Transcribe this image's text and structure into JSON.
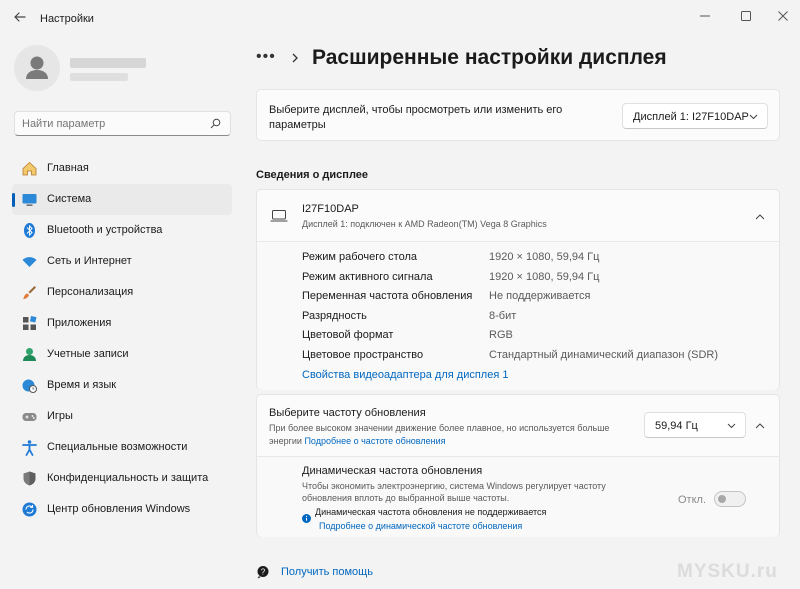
{
  "window": {
    "title": "Настройки"
  },
  "search": {
    "placeholder": "Найти параметр"
  },
  "sidebar": {
    "items": [
      {
        "label": "Главная",
        "icon": "home-icon"
      },
      {
        "label": "Система",
        "icon": "system-icon",
        "active": true
      },
      {
        "label": "Bluetooth и устройства",
        "icon": "bluetooth-icon"
      },
      {
        "label": "Сеть и Интернет",
        "icon": "wifi-icon"
      },
      {
        "label": "Персонализация",
        "icon": "brush-icon"
      },
      {
        "label": "Приложения",
        "icon": "apps-icon"
      },
      {
        "label": "Учетные записи",
        "icon": "account-icon"
      },
      {
        "label": "Время и язык",
        "icon": "globe-clock-icon"
      },
      {
        "label": "Игры",
        "icon": "gamepad-icon"
      },
      {
        "label": "Специальные возможности",
        "icon": "accessibility-icon"
      },
      {
        "label": "Конфиденциальность и защита",
        "icon": "shield-icon"
      },
      {
        "label": "Центр обновления Windows",
        "icon": "update-icon"
      }
    ]
  },
  "main": {
    "breadcrumb_more": "•••",
    "title": "Расширенные настройки дисплея",
    "select_display": {
      "text": "Выберите дисплей, чтобы просмотреть или изменить его параметры",
      "value": "Дисплей 1: I27F10DAP"
    },
    "section_title": "Сведения о дисплее",
    "display_info": {
      "name": "I27F10DAP",
      "subtitle": "Дисплей 1: подключен к AMD Radeon(TM) Vega 8 Graphics",
      "rows": [
        {
          "key": "Режим рабочего стола",
          "value": "1920 × 1080, 59,94 Гц"
        },
        {
          "key": "Режим активного сигнала",
          "value": "1920 × 1080, 59,94 Гц"
        },
        {
          "key": "Переменная частота обновления",
          "value": "Не поддерживается"
        },
        {
          "key": "Разрядность",
          "value": "8-бит"
        },
        {
          "key": "Цветовой формат",
          "value": "RGB"
        },
        {
          "key": "Цветовое пространство",
          "value": "Стандартный динамический диапазон (SDR)"
        }
      ],
      "adapter_link": "Свойства видеоадаптера для дисплея 1"
    },
    "refresh": {
      "title": "Выберите частоту обновления",
      "desc": "При более высоком значении движение более плавное, но используется больше энергии",
      "desc_link": "Подробнее о частоте обновления",
      "value": "59,94 Гц",
      "dynamic": {
        "title": "Динамическая частота обновления",
        "desc": "Чтобы экономить электроэнергию, система Windows регулирует частоту обновления вплоть до выбранной выше частоты.",
        "warning": "Динамическая частота обновления не поддерживается",
        "link": "Подробнее о динамической частоте обновления",
        "toggle_label": "Откл.",
        "toggle_on": false
      }
    },
    "help_link": "Получить помощь"
  },
  "watermark": "MYSKU.ru",
  "colors": {
    "accent": "#005fb8",
    "link": "#0067c0",
    "background": "#f3f3f3",
    "card": "#fbfbfb"
  }
}
